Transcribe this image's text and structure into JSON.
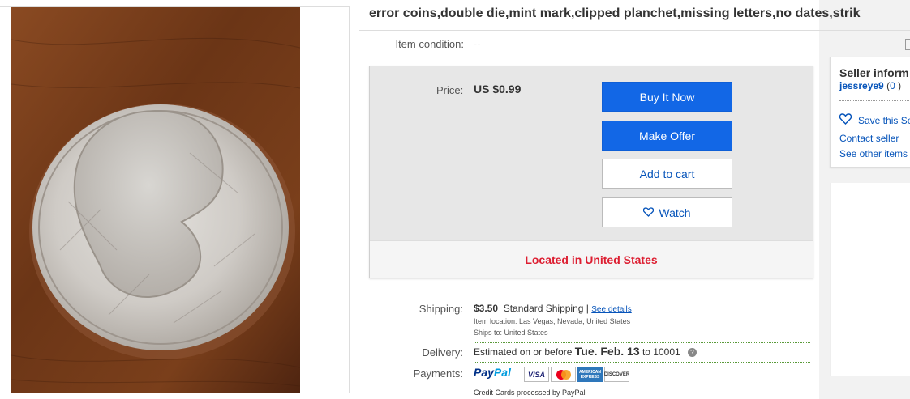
{
  "listing": {
    "title": "error coins,double die,mint mark,clipped planchet,missing letters,no dates,strik",
    "condition_label": "Item condition:",
    "condition_value": "--"
  },
  "buybox": {
    "price_label": "Price:",
    "price_value": "US $0.99",
    "buy_now_label": "Buy It Now",
    "make_offer_label": "Make Offer",
    "add_to_cart_label": "Add to cart",
    "watch_label": "Watch",
    "location_text": "Located in United States"
  },
  "shipping": {
    "label": "Shipping:",
    "cost": "$3.50",
    "method": "Standard Shipping",
    "separator": "|",
    "see_details": "See details",
    "item_location": "Item location:  Las Vegas, Nevada, United States",
    "ships_to": "Ships to:  United States"
  },
  "delivery": {
    "label": "Delivery:",
    "prefix": "Estimated on or before",
    "date": "Tue. Feb. 13",
    "suffix": "to 10001",
    "help_glyph": "?"
  },
  "payments": {
    "label": "Payments:",
    "paypal_a": "Pay",
    "paypal_b": "Pal",
    "visa": "VISA",
    "amex": "AMERICAN EXPRESS",
    "discover": "DISCOVER",
    "note": "Credit Cards processed by PayPal"
  },
  "seller": {
    "heading": "Seller inform",
    "name": "jessreye9",
    "score_open": "(",
    "score": "0",
    "score_close": " )",
    "save_label": "Save this Se",
    "contact_label": "Contact seller",
    "see_other_label": "See other items"
  },
  "colors": {
    "primary_button": "#1267e6",
    "link": "#0654ba",
    "location_red": "#dd1e31"
  },
  "icons": [
    "heart-icon",
    "help-icon",
    "condition-icon"
  ]
}
